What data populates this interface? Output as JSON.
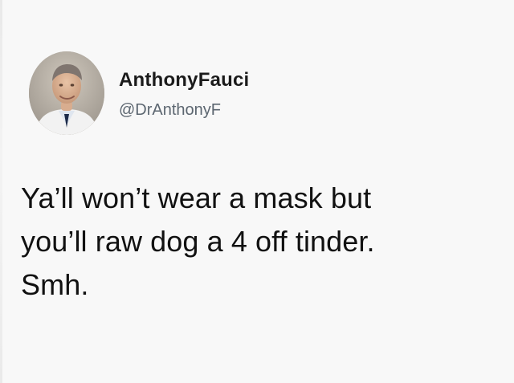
{
  "tweet": {
    "author": {
      "display_name": "AnthonyFauci",
      "handle": "@DrAnthonyF",
      "avatar_icon": "profile-photo"
    },
    "text_lines": [
      "Ya’ll won’t wear a mask but",
      "you’ll raw dog a 4 off tinder.",
      "Smh."
    ]
  },
  "colors": {
    "background": "#f8f8f8",
    "name_text": "#1b1b1b",
    "handle_text": "#5c6670",
    "body_text": "#111111"
  }
}
